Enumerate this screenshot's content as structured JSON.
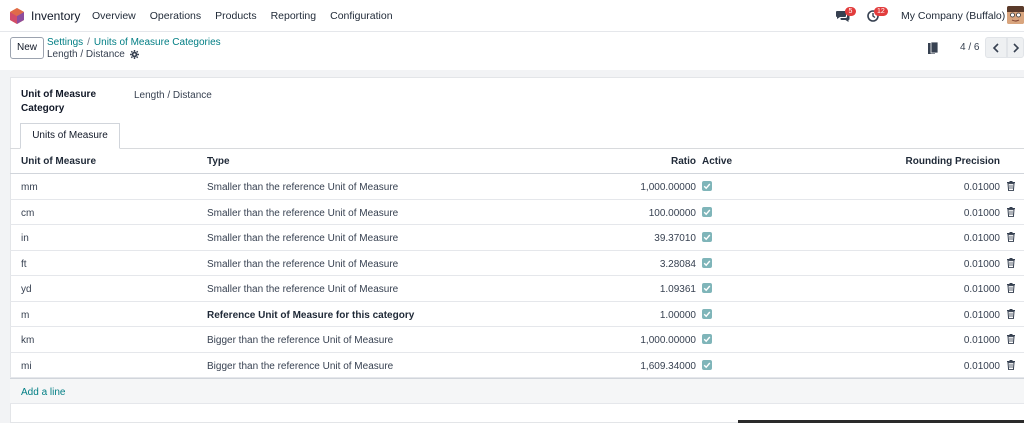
{
  "navbar": {
    "app_name": "Inventory",
    "menu": [
      "Overview",
      "Operations",
      "Products",
      "Reporting",
      "Configuration"
    ],
    "messages_count": "5",
    "activities_count": "12",
    "company": "My Company (Buffalo)"
  },
  "control": {
    "new_label": "New",
    "breadcrumb": [
      "Settings",
      "Units of Measure Categories"
    ],
    "breadcrumb_sep": "/",
    "record_title": "Length / Distance",
    "pager": "4 / 6"
  },
  "form": {
    "category_label": "Unit of Measure Category",
    "category_value": "Length / Distance",
    "tab_label": "Units of Measure"
  },
  "table": {
    "headers": {
      "uom": "Unit of Measure",
      "type": "Type",
      "ratio": "Ratio",
      "active": "Active",
      "rounding": "Rounding Precision"
    },
    "rows": [
      {
        "uom": "mm",
        "type": "Smaller than the reference Unit of Measure",
        "ratio": "1,000.00000",
        "rounding": "0.01000"
      },
      {
        "uom": "cm",
        "type": "Smaller than the reference Unit of Measure",
        "ratio": "100.00000",
        "rounding": "0.01000"
      },
      {
        "uom": "in",
        "type": "Smaller than the reference Unit of Measure",
        "ratio": "39.37010",
        "rounding": "0.01000"
      },
      {
        "uom": "ft",
        "type": "Smaller than the reference Unit of Measure",
        "ratio": "3.28084",
        "rounding": "0.01000"
      },
      {
        "uom": "yd",
        "type": "Smaller than the reference Unit of Measure",
        "ratio": "1.09361",
        "rounding": "0.01000"
      },
      {
        "uom": "m",
        "type": "Reference Unit of Measure for this category",
        "ratio": "1.00000",
        "rounding": "0.01000"
      },
      {
        "uom": "km",
        "type": "Bigger than the reference Unit of Measure",
        "ratio": "1,000.00000",
        "rounding": "0.01000"
      },
      {
        "uom": "mi",
        "type": "Bigger than the reference Unit of Measure",
        "ratio": "1,609.34000",
        "rounding": "0.01000"
      }
    ],
    "add_line_label": "Add a line"
  },
  "colors": {
    "accent": "#017e84",
    "badge": "#e23d3d",
    "checkbox": "#7fb5b9"
  }
}
